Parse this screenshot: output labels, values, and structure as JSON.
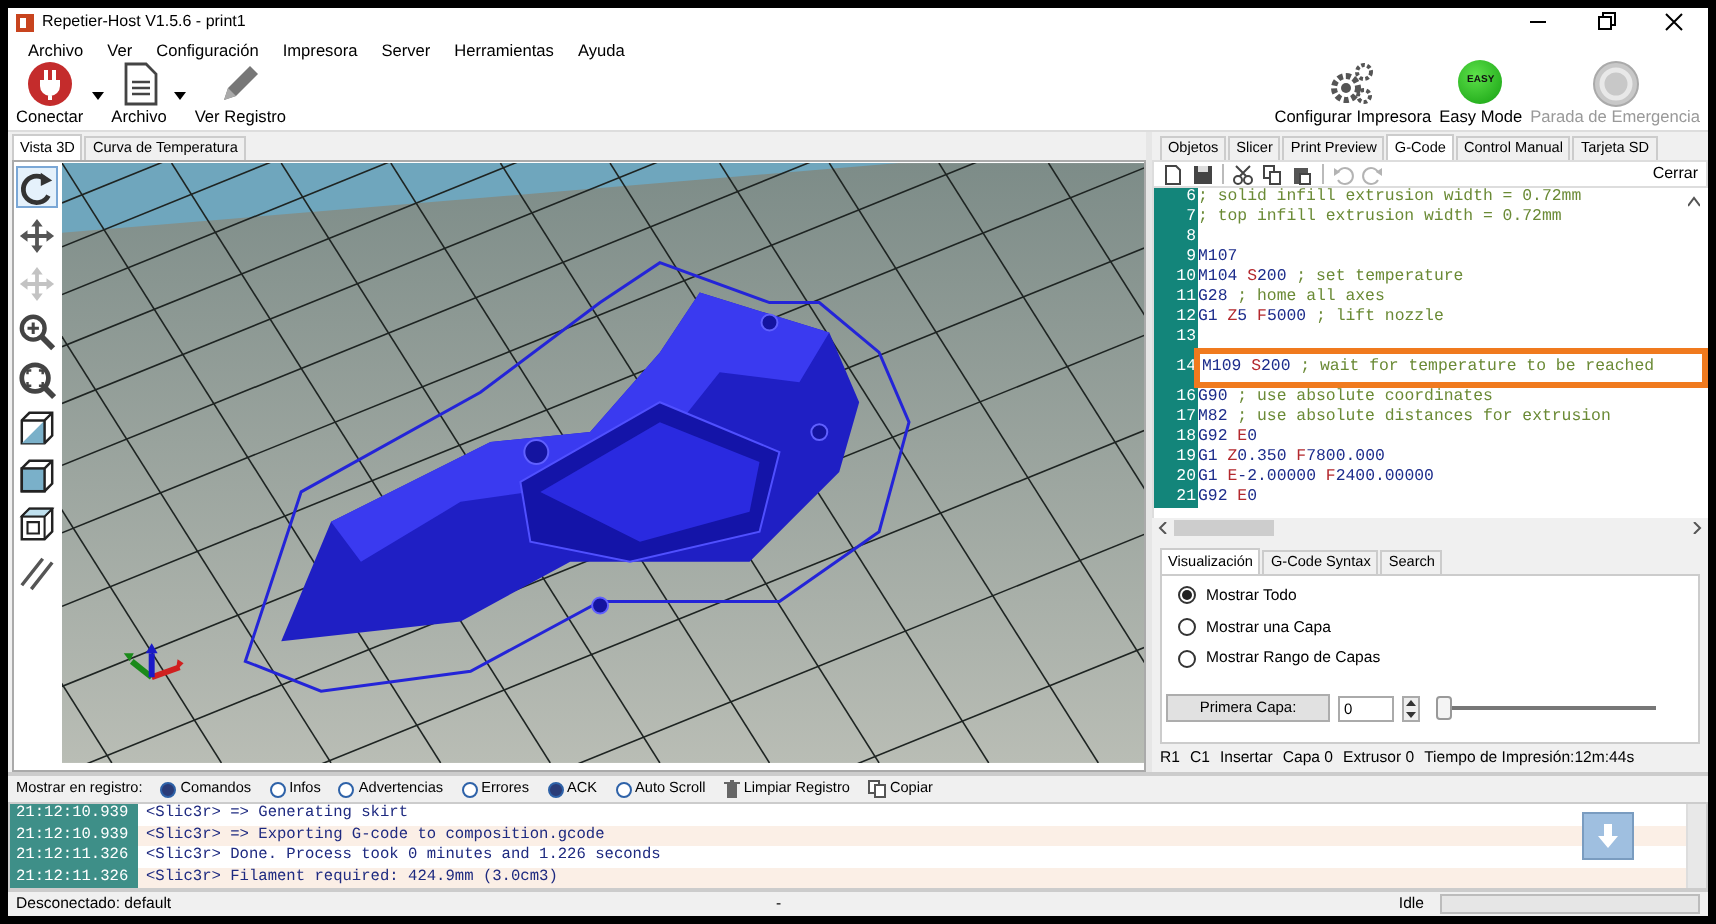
{
  "window": {
    "title": "Repetier-Host V1.5.6 - print1"
  },
  "menu": [
    "Archivo",
    "Ver",
    "Configuración",
    "Impresora",
    "Server",
    "Herramientas",
    "Ayuda"
  ],
  "toolbar": {
    "left": [
      {
        "label": "Conectar",
        "kind": "plug",
        "dropdown": true
      },
      {
        "label": "Archivo",
        "kind": "file",
        "dropdown": true
      },
      {
        "label": "Ver Registro",
        "kind": "pencil",
        "dropdown": false
      }
    ],
    "right": [
      {
        "label": "Configurar Impresora",
        "kind": "gears",
        "disabled": false
      },
      {
        "label": "Easy Mode",
        "kind": "easy",
        "badge": "EASY",
        "disabled": false
      },
      {
        "label": "Parada de Emergencia",
        "kind": "stop",
        "disabled": true
      }
    ]
  },
  "view_tabs": [
    {
      "label": "Vista 3D",
      "selected": true
    },
    {
      "label": "Curva de Temperatura",
      "selected": false
    }
  ],
  "view_tools": [
    {
      "kind": "rotate",
      "selected": true,
      "disabled": false
    },
    {
      "kind": "move",
      "selected": false,
      "disabled": false
    },
    {
      "kind": "move",
      "selected": false,
      "disabled": true
    },
    {
      "kind": "zoom",
      "selected": false,
      "disabled": false
    },
    {
      "kind": "fit",
      "selected": false,
      "disabled": false
    },
    {
      "kind": "cube-diagonal",
      "selected": false,
      "disabled": false
    },
    {
      "kind": "cube-solid",
      "selected": false,
      "disabled": false
    },
    {
      "kind": "cube-wire",
      "selected": false,
      "disabled": false
    },
    {
      "kind": "parallel",
      "selected": false,
      "disabled": false
    }
  ],
  "editor_tabs": [
    {
      "label": "Objetos",
      "selected": false
    },
    {
      "label": "Slicer",
      "selected": false
    },
    {
      "label": "Print Preview",
      "selected": false
    },
    {
      "label": "G-Code",
      "selected": true
    },
    {
      "label": "Control Manual",
      "selected": false
    },
    {
      "label": "Tarjeta SD",
      "selected": false
    }
  ],
  "editor_tools": [
    {
      "kind": "new",
      "disabled": false
    },
    {
      "kind": "save",
      "disabled": false
    },
    {
      "kind": "cut",
      "disabled": false
    },
    {
      "kind": "copy",
      "disabled": false
    },
    {
      "kind": "paste",
      "disabled": false
    },
    {
      "kind": "undo",
      "disabled": true
    },
    {
      "kind": "redo",
      "disabled": true
    }
  ],
  "editor_close": "Cerrar",
  "gcode": [
    {
      "number": "6",
      "comment": "; solid infill extrusion width = 0.72mm",
      "highlighted": false
    },
    {
      "number": "7",
      "comment": "; top infill extrusion width = 0.72mm",
      "highlighted": false
    },
    {
      "number": "8",
      "highlighted": false
    },
    {
      "number": "9",
      "code": "M107",
      "highlighted": false
    },
    {
      "number": "10",
      "code": "M104 S200",
      "comment": "; set temperature",
      "highlighted": false
    },
    {
      "number": "11",
      "code": "G28",
      "comment": "; home all axes",
      "highlighted": false
    },
    {
      "number": "12",
      "code": "G1 Z5 F5000",
      "comment": "; lift nozzle",
      "highlighted": false
    },
    {
      "number": "13",
      "highlighted": false
    },
    {
      "number": "14",
      "code": "M109 S200",
      "comment": "; wait for temperature to be reached",
      "highlighted": true
    },
    {
      "number": "16",
      "code": "G90",
      "comment": "; use absolute coordinates",
      "highlighted": false
    },
    {
      "number": "17",
      "code": "M82",
      "comment": "; use absolute distances for extrusion",
      "highlighted": false
    },
    {
      "number": "18",
      "code": "G92 E0",
      "highlighted": false
    },
    {
      "number": "19",
      "code": "G1 Z0.350 F7800.000",
      "highlighted": false
    },
    {
      "number": "20",
      "code": "G1 E-2.00000 F2400.00000",
      "highlighted": false
    },
    {
      "number": "21",
      "code": "G92 E0",
      "highlighted": false
    }
  ],
  "options_tabs": [
    {
      "label": "Visualización",
      "selected": true
    },
    {
      "label": "G-Code Syntax",
      "selected": false
    },
    {
      "label": "Search",
      "selected": false
    }
  ],
  "options": [
    {
      "label": "Mostrar Todo",
      "selected": true
    },
    {
      "label": "Mostrar una Capa",
      "selected": false
    },
    {
      "label": "Mostrar Rango de Capas",
      "selected": false
    }
  ],
  "layer": {
    "button": "Primera Capa:",
    "value": "0",
    "level": 0
  },
  "editor_status": [
    "R1",
    "C1",
    "Insertar",
    "Capa 0",
    "Extrusor 0",
    "Tiempo de Impresión:12m:44s"
  ],
  "log_label": "Mostrar en registro:",
  "log_filters": [
    {
      "label": "Comandos",
      "kind": "toggle",
      "on": true
    },
    {
      "label": "Infos",
      "kind": "toggle",
      "on": false
    },
    {
      "label": "Advertencias",
      "kind": "toggle",
      "on": false
    },
    {
      "label": "Errores",
      "kind": "toggle",
      "on": false
    },
    {
      "label": "ACK",
      "kind": "toggle",
      "on": true
    },
    {
      "label": "Auto Scroll",
      "kind": "toggle",
      "on": false
    },
    {
      "label": "Limpiar Registro",
      "kind": "clear"
    },
    {
      "label": "Copiar",
      "kind": "copy"
    }
  ],
  "log": [
    {
      "time": "21:12:10.939",
      "text": "<Slic3r> => Generating skirt"
    },
    {
      "time": "21:12:10.939",
      "text": "<Slic3r> => Exporting G-code to composition.gcode"
    },
    {
      "time": "21:12:11.326",
      "text": "<Slic3r> Done. Process took 0 minutes and 1.226 seconds"
    },
    {
      "time": "21:12:11.326",
      "text": "<Slic3r> Filament required: 424.9mm (3.0cm3)"
    }
  ],
  "status_bar": {
    "connection": "Desconectado: default",
    "center": "-",
    "state": "Idle",
    "level": 0
  }
}
